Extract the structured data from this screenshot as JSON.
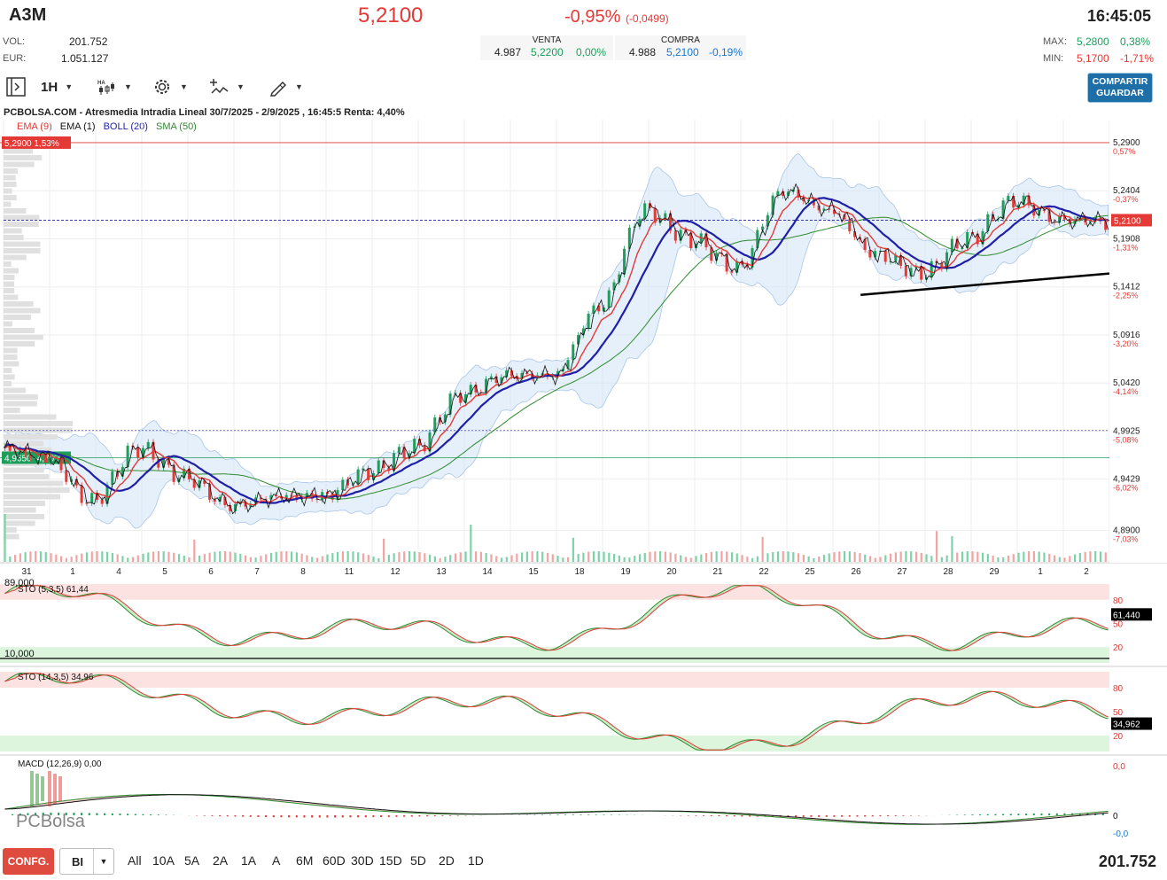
{
  "header": {
    "ticker": "A3M",
    "price": "5,2100",
    "change_pct": "-0,95%",
    "change_abs": "(-0,0499)",
    "time": "16:45:05",
    "vol_label": "VOL:",
    "vol_value": "201.752",
    "eur_label": "EUR:",
    "eur_value": "1.051.127",
    "venta_label": "VENTA",
    "venta_qty": "4.987",
    "venta_price": "5,2200",
    "venta_pct": "0,00%",
    "compra_label": "COMPRA",
    "compra_qty": "4.988",
    "compra_price": "5,2100",
    "compra_pct": "-0,19%",
    "max_label": "MAX:",
    "max_value": "5,2800",
    "max_pct": "0,38%",
    "min_label": "MIN:",
    "min_value": "5,1700",
    "min_pct": "-1,71%"
  },
  "toolbar": {
    "interval": "1H",
    "share_line1": "COMPARTIR",
    "share_line2": "GUARDAR"
  },
  "chart_title": "PCBOLSA.COM - Atresmedia Intradia Lineal 30/7/2025 - 2/9/2025 , 16:45:5 Renta: 4,40%",
  "legend": {
    "ema9": "EMA (9)",
    "ema1": "EMA (1)",
    "boll": "BOLL (20)",
    "sma": "SMA (50)"
  },
  "colors": {
    "up": "#1e9e5c",
    "down": "#e53935",
    "boll": "#1f1fa8",
    "sma": "#2e8b2e",
    "band": "#d6e6f7"
  },
  "watermark": "PCBolsa",
  "bottom": {
    "config": "CONFG.",
    "mode": "BI",
    "periods": [
      "All",
      "10A",
      "5A",
      "2A",
      "1A",
      "A",
      "6M",
      "60D",
      "30D",
      "15D",
      "5D",
      "2D",
      "1D"
    ],
    "volume": "201.752"
  },
  "chart_data": [
    {
      "type": "line",
      "title": "",
      "x": [
        "31",
        "1",
        "4",
        "5",
        "6",
        "7",
        "8",
        "11",
        "12",
        "13",
        "14",
        "15",
        "18",
        "19",
        "20",
        "21",
        "22",
        "25",
        "26",
        "27",
        "28",
        "29",
        "1",
        "2"
      ],
      "y_ticks": [
        "5,2900",
        "5,2404",
        "5,1908",
        "5,1412",
        "5,0916",
        "5,0420",
        "4,9925",
        "4,9429",
        "4,8900"
      ],
      "y_tick_pcts": [
        "0,57%",
        "-0,37%",
        "-1,31%",
        "-2,25%",
        "-3,20%",
        "-4,14%",
        "-5,08%",
        "-6,02%",
        "-7,03%"
      ],
      "ylim": [
        4.885,
        5.3
      ],
      "levels": [
        {
          "label": "5,2900  1,53%",
          "value": 5.29,
          "color": "#e53935"
        },
        {
          "label": "4,9650  -4,70%",
          "value": 4.965,
          "color": "#1e9e5c"
        }
      ],
      "current_price_label": "5,2100",
      "close_by_day": [
        4.975,
        4.965,
        4.92,
        4.975,
        4.945,
        4.915,
        4.925,
        4.925,
        4.95,
        4.975,
        5.03,
        5.05,
        5.05,
        5.12,
        5.22,
        5.19,
        5.16,
        5.24,
        5.22,
        5.175,
        5.155,
        5.19,
        5.23,
        5.21
      ],
      "neckline": [
        [
          18.6,
          5.133
        ],
        [
          24,
          5.155
        ]
      ],
      "series": [
        {
          "name": "EMA (9)"
        },
        {
          "name": "EMA (1)"
        },
        {
          "name": "BOLL (20)"
        },
        {
          "name": "SMA (50)"
        }
      ],
      "volume_axis_labels": [
        "89,000",
        "10,000"
      ]
    },
    {
      "type": "line",
      "title": "STO (5,3,5)",
      "last_value_label": "61,44",
      "last_value": "61,440",
      "y_ticks": [
        "80",
        "50",
        "20"
      ],
      "ylim": [
        0,
        100
      ]
    },
    {
      "type": "line",
      "title": "STO (14,3,5)",
      "last_value_label": "34,96",
      "last_value": "34,962",
      "y_ticks": [
        "80",
        "50",
        "20"
      ],
      "ylim": [
        0,
        100
      ]
    },
    {
      "type": "bar",
      "title": "MACD (12,26,9)",
      "last_value_label": "0,00",
      "y_ticks": [
        "0,0",
        "0",
        "-0,0"
      ]
    }
  ]
}
